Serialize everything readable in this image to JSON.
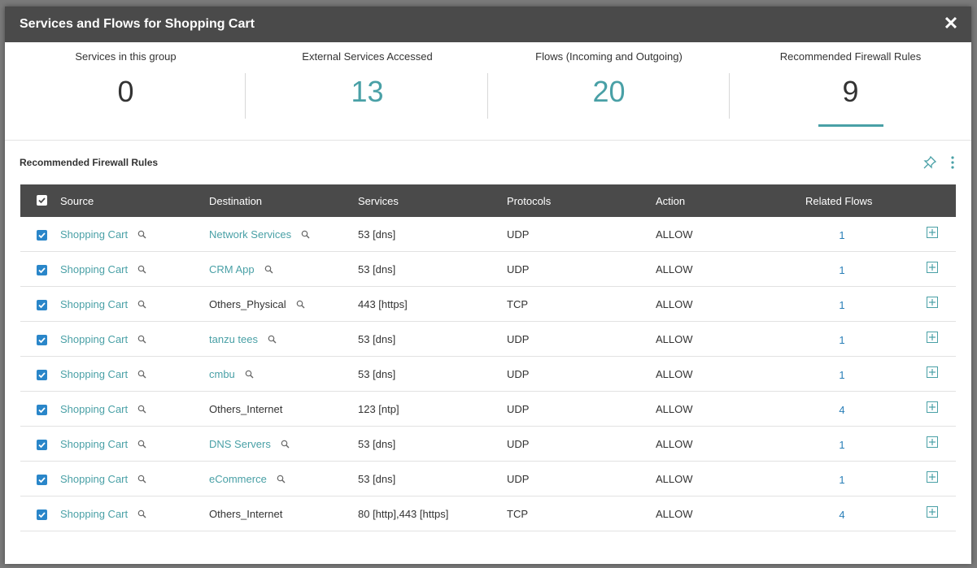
{
  "modal": {
    "title": "Services and Flows for Shopping Cart"
  },
  "stats": [
    {
      "label": "Services in this group",
      "value": "0"
    },
    {
      "label": "External Services Accessed",
      "value": "13"
    },
    {
      "label": "Flows (Incoming and Outgoing)",
      "value": "20"
    },
    {
      "label": "Recommended Firewall Rules",
      "value": "9"
    }
  ],
  "section": {
    "title": "Recommended Firewall Rules"
  },
  "table": {
    "headers": {
      "source": "Source",
      "destination": "Destination",
      "services": "Services",
      "protocols": "Protocols",
      "action": "Action",
      "related": "Related Flows"
    },
    "rows": [
      {
        "source": "Shopping Cart",
        "destination": "Network Services",
        "services": "53 [dns]",
        "protocol": "UDP",
        "action": "ALLOW",
        "related": "1"
      },
      {
        "source": "Shopping Cart",
        "destination": "CRM App",
        "services": "53 [dns]",
        "protocol": "UDP",
        "action": "ALLOW",
        "related": "1"
      },
      {
        "source": "Shopping Cart",
        "destination": "Others_Physical",
        "services": "443 [https]",
        "protocol": "TCP",
        "action": "ALLOW",
        "related": "1"
      },
      {
        "source": "Shopping Cart",
        "destination": "tanzu tees",
        "services": "53 [dns]",
        "protocol": "UDP",
        "action": "ALLOW",
        "related": "1"
      },
      {
        "source": "Shopping Cart",
        "destination": "cmbu",
        "services": "53 [dns]",
        "protocol": "UDP",
        "action": "ALLOW",
        "related": "1"
      },
      {
        "source": "Shopping Cart",
        "destination": "Others_Internet",
        "services": "123 [ntp]",
        "protocol": "UDP",
        "action": "ALLOW",
        "related": "4"
      },
      {
        "source": "Shopping Cart",
        "destination": "DNS Servers",
        "services": "53 [dns]",
        "protocol": "UDP",
        "action": "ALLOW",
        "related": "1"
      },
      {
        "source": "Shopping Cart",
        "destination": "eCommerce",
        "services": "53 [dns]",
        "protocol": "UDP",
        "action": "ALLOW",
        "related": "1"
      },
      {
        "source": "Shopping Cart",
        "destination": "Others_Internet",
        "services": "80 [http],443 [https]",
        "protocol": "TCP",
        "action": "ALLOW",
        "related": "4"
      }
    ]
  },
  "colors": {
    "header_bg": "#4a4a4a",
    "accent": "#49a0a6",
    "checkbox": "#2a86c9",
    "related_link": "#2a7fb8"
  },
  "icons": {
    "close": "close-icon",
    "pin": "pin-icon",
    "more": "more-vertical-icon",
    "search": "magnifier-icon",
    "expand": "plus-box-icon"
  }
}
